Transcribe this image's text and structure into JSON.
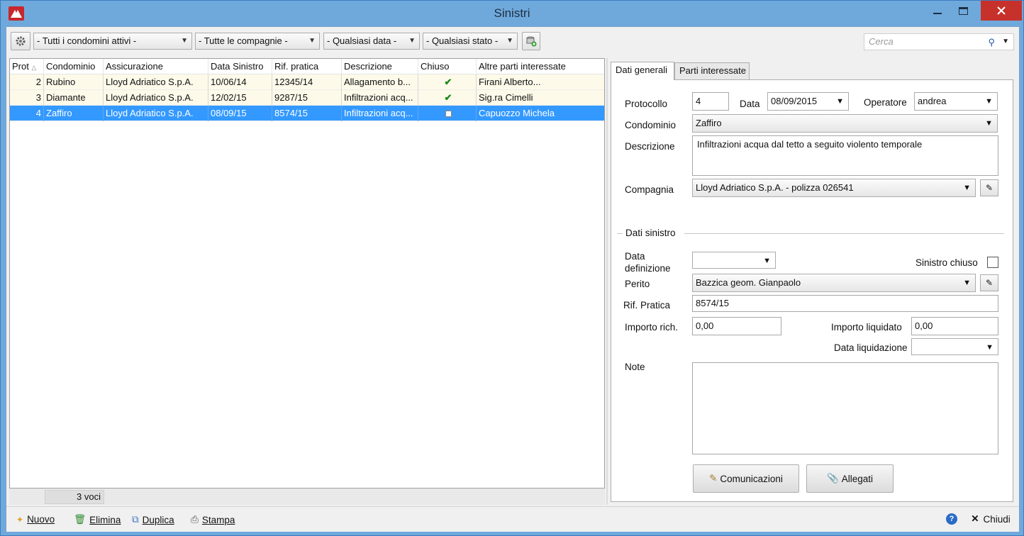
{
  "window": {
    "title": "Sinistri"
  },
  "toolbar": {
    "filter_condomini": "- Tutti i condomini attivi -",
    "filter_compagnie": "- Tutte le compagnie -",
    "filter_data": "- Qualsiasi data -",
    "filter_stato": "- Qualsiasi stato -",
    "search_placeholder": "Cerca"
  },
  "grid": {
    "columns": [
      "Prot",
      "Condominio",
      "Assicurazione",
      "Data Sinistro",
      "Rif. pratica",
      "Descrizione",
      "Chiuso",
      "Altre parti interessate"
    ],
    "rows": [
      {
        "prot": "2",
        "condominio": "Rubino",
        "assicurazione": "Lloyd Adriatico S.p.A.",
        "data": "10/06/14",
        "rif": "12345/14",
        "descrizione": "Allagamento b...",
        "chiuso": true,
        "altre": "Firani Alberto..."
      },
      {
        "prot": "3",
        "condominio": "Diamante",
        "assicurazione": "Lloyd Adriatico S.p.A.",
        "data": "12/02/15",
        "rif": "9287/15",
        "descrizione": "Infiltrazioni acq...",
        "chiuso": true,
        "altre": "Sig.ra Cimelli"
      },
      {
        "prot": "4",
        "condominio": "Zaffiro",
        "assicurazione": "Lloyd Adriatico S.p.A.",
        "data": "08/09/15",
        "rif": "8574/15",
        "descrizione": "Infiltrazioni acq...",
        "chiuso": false,
        "altre": "Capuozzo Michela"
      }
    ],
    "count": "3 voci"
  },
  "tabs": [
    "Dati generali",
    "Parti interessate"
  ],
  "form": {
    "protocollo_label": "Protocollo",
    "protocollo": "4",
    "data_label": "Data",
    "data": "08/09/2015",
    "operatore_label": "Operatore",
    "operatore": "andrea",
    "condominio_label": "Condominio",
    "condominio": "Zaffiro",
    "descrizione_label": "Descrizione",
    "descrizione": "Infiltrazioni acqua dal tetto a seguito violento temporale",
    "compagnia_label": "Compagnia",
    "compagnia": "Lloyd Adriatico S.p.A. - polizza 026541",
    "section_label": "Dati sinistro",
    "data_def_label_1": "Data",
    "data_def_label_2": "definizione",
    "data_def": "",
    "sinistro_chiuso_label": "Sinistro chiuso",
    "sinistro_chiuso": false,
    "perito_label": "Perito",
    "perito": "Bazzica geom. Gianpaolo",
    "rif_label": "Rif. Pratica",
    "rif": "8574/15",
    "importo_rich_label": "Importo rich.",
    "importo_rich": "0,00",
    "importo_liq_label": "Importo liquidato",
    "importo_liq": "0,00",
    "data_liq_label": "Data liquidazione",
    "data_liq": "",
    "note_label": "Note",
    "note": "",
    "comunicazioni_label": "Comunicazioni",
    "allegati_label": "Allegati"
  },
  "bottombar": {
    "nuovo": "Nuovo",
    "elimina": "Elimina",
    "duplica": "Duplica",
    "stampa": "Stampa",
    "chiudi": "Chiudi"
  },
  "colors": {
    "titlebar": "#6fa9dc",
    "selection": "#3399ff",
    "row_bg": "#fdfaea",
    "close": "#c7312b"
  }
}
